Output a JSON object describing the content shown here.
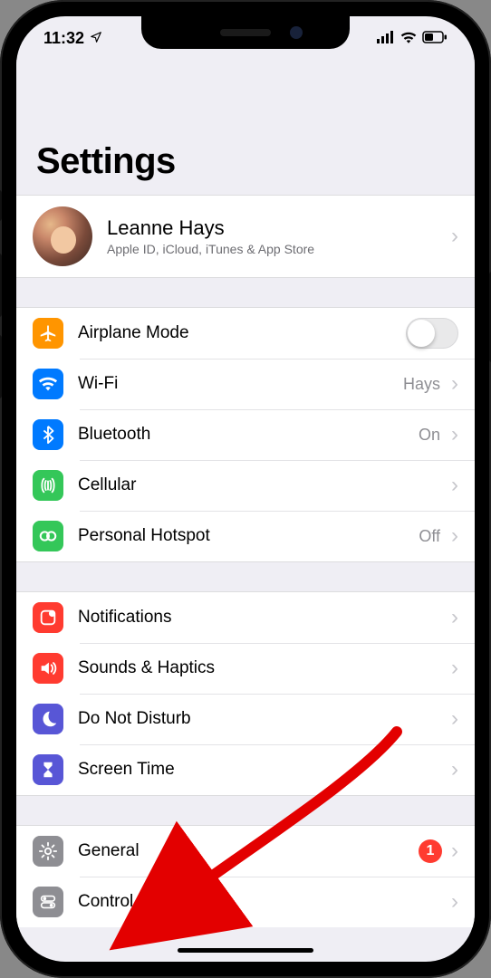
{
  "statusbar": {
    "time": "11:32"
  },
  "header": {
    "title": "Settings"
  },
  "account": {
    "name": "Leanne Hays",
    "subtitle": "Apple ID, iCloud, iTunes & App Store"
  },
  "groups": [
    {
      "rows": [
        {
          "id": "airplane",
          "label": "Airplane Mode",
          "iconClass": "ic-orange",
          "icon": "airplane",
          "type": "toggle",
          "value": "off"
        },
        {
          "id": "wifi",
          "label": "Wi-Fi",
          "iconClass": "ic-blue",
          "icon": "wifi",
          "type": "nav",
          "detail": "Hays"
        },
        {
          "id": "bluetooth",
          "label": "Bluetooth",
          "iconClass": "ic-blue",
          "icon": "bluetooth",
          "type": "nav",
          "detail": "On"
        },
        {
          "id": "cellular",
          "label": "Cellular",
          "iconClass": "ic-green",
          "icon": "cellular",
          "type": "nav"
        },
        {
          "id": "hotspot",
          "label": "Personal Hotspot",
          "iconClass": "ic-green",
          "icon": "hotspot",
          "type": "nav",
          "detail": "Off"
        }
      ]
    },
    {
      "rows": [
        {
          "id": "notifications",
          "label": "Notifications",
          "iconClass": "ic-red",
          "icon": "notifications",
          "type": "nav"
        },
        {
          "id": "sounds",
          "label": "Sounds & Haptics",
          "iconClass": "ic-red",
          "icon": "sounds",
          "type": "nav"
        },
        {
          "id": "dnd",
          "label": "Do Not Disturb",
          "iconClass": "ic-indigo",
          "icon": "moon",
          "type": "nav"
        },
        {
          "id": "screentime",
          "label": "Screen Time",
          "iconClass": "ic-indigo",
          "icon": "hourglass",
          "type": "nav"
        }
      ]
    },
    {
      "rows": [
        {
          "id": "general",
          "label": "General",
          "iconClass": "ic-gray",
          "icon": "gear",
          "type": "nav",
          "badge": "1"
        },
        {
          "id": "control",
          "label": "Control Center",
          "iconClass": "ic-gray",
          "icon": "switches",
          "type": "nav"
        }
      ]
    }
  ]
}
